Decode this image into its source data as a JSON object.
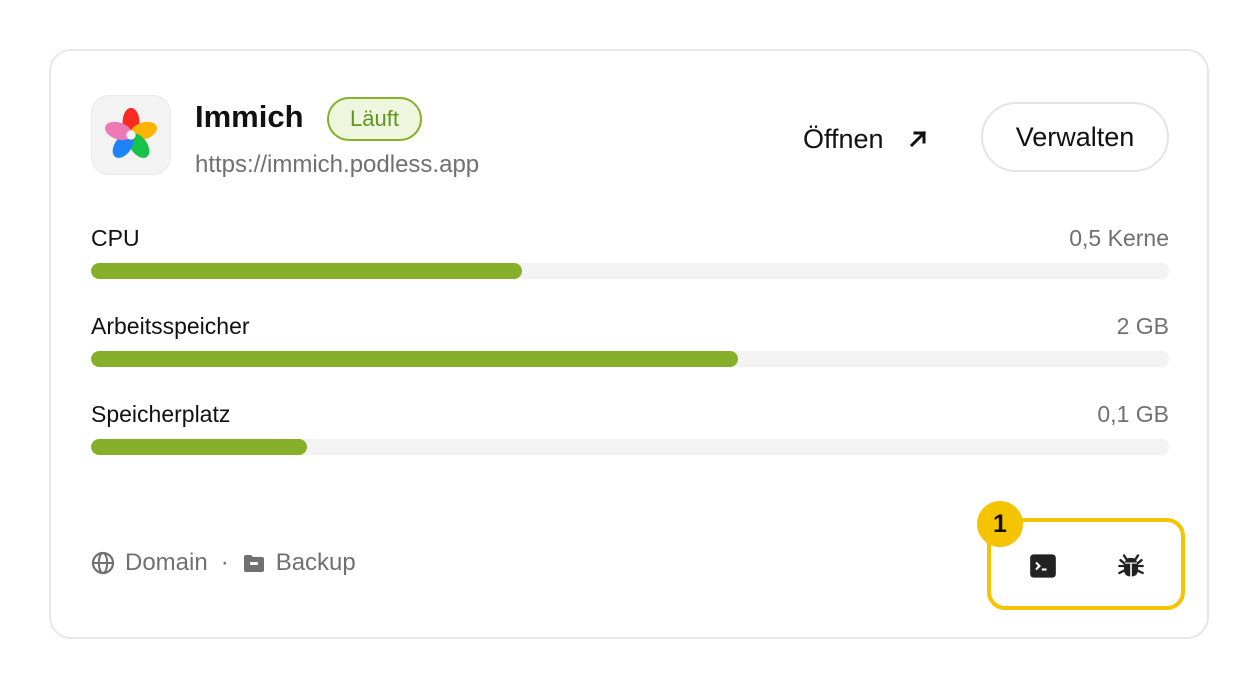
{
  "app": {
    "name": "Immich",
    "status": "Läuft",
    "url": "https://immich.podless.app",
    "icon": "immich-pinwheel-logo",
    "open_label": "Öffnen",
    "manage_label": "Verwalten"
  },
  "metrics": [
    {
      "label": "CPU",
      "value": "0,5 Kerne",
      "fraction": 0.4
    },
    {
      "label": "Arbeitsspeicher",
      "value": "2 GB",
      "fraction": 0.6
    },
    {
      "label": "Speicherplatz",
      "value": "0,1 GB",
      "fraction": 0.2
    }
  ],
  "footer": {
    "links": [
      {
        "label": "Domain",
        "icon": "globe-icon"
      },
      {
        "label": "Backup",
        "icon": "folder-lock-icon"
      }
    ],
    "separator": "·",
    "tools": [
      {
        "name": "terminal",
        "icon": "terminal-icon"
      },
      {
        "name": "debug",
        "icon": "bug-icon"
      }
    ],
    "marker": "1"
  },
  "colors": {
    "accent": "#86b02a",
    "badge_bg": "#eef6de",
    "badge_text": "#5f9421",
    "track": "#f3f3f3",
    "highlight": "#f5c400"
  }
}
